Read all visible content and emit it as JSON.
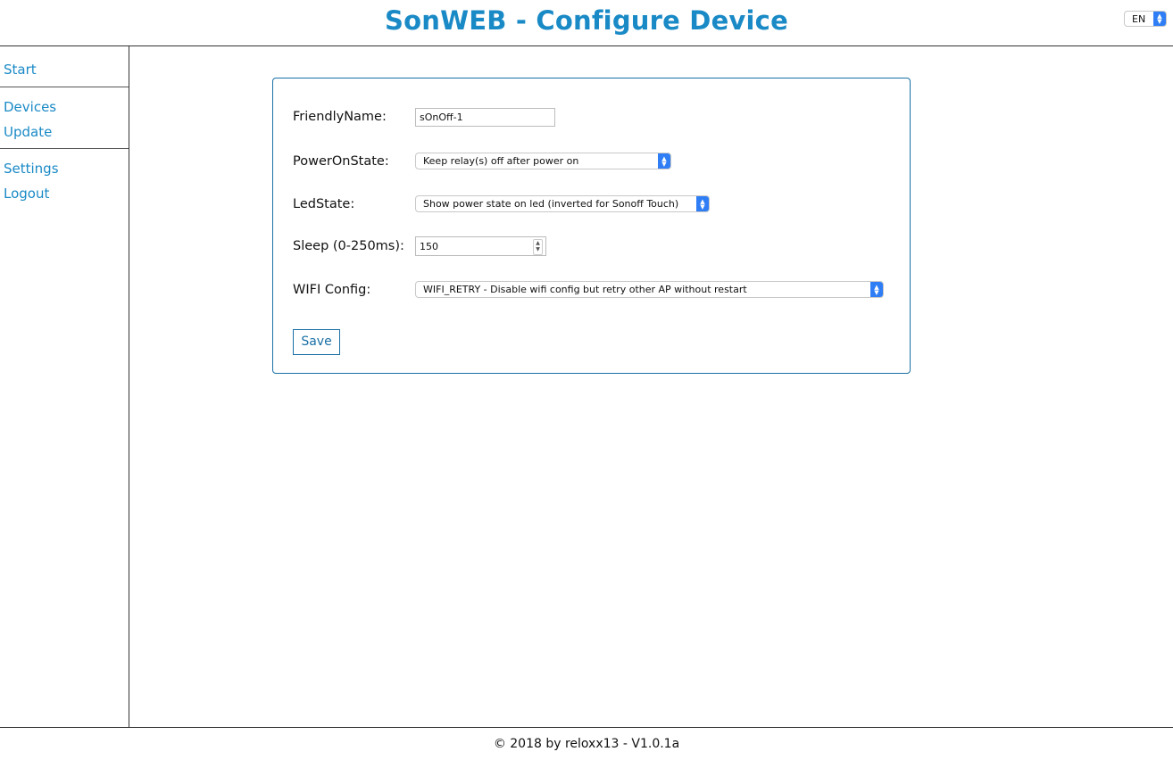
{
  "header": {
    "title": "SonWEB - Configure Device",
    "language": "EN"
  },
  "sidebar": {
    "groups": [
      {
        "items": [
          {
            "label": "Start"
          }
        ]
      },
      {
        "items": [
          {
            "label": "Devices"
          },
          {
            "label": "Update"
          }
        ]
      },
      {
        "items": [
          {
            "label": "Settings"
          },
          {
            "label": "Logout"
          }
        ]
      }
    ]
  },
  "form": {
    "friendly_name": {
      "label": "FriendlyName:",
      "value": "sOnOff-1"
    },
    "power_on_state": {
      "label": "PowerOnState:",
      "value": "Keep relay(s) off after power on"
    },
    "led_state": {
      "label": "LedState:",
      "value": "Show power state on led (inverted for Sonoff Touch)"
    },
    "sleep": {
      "label": "Sleep (0-250ms):",
      "value": "150"
    },
    "wifi_config": {
      "label": "WIFI Config:",
      "value": "WIFI_RETRY - Disable wifi config but retry other AP without restart"
    },
    "save_label": "Save"
  },
  "footer": {
    "text": "© 2018 by reloxx13 - V1.0.1a"
  },
  "colors": {
    "accent": "#1a8ac6",
    "select_button": "#2f7ef5"
  }
}
